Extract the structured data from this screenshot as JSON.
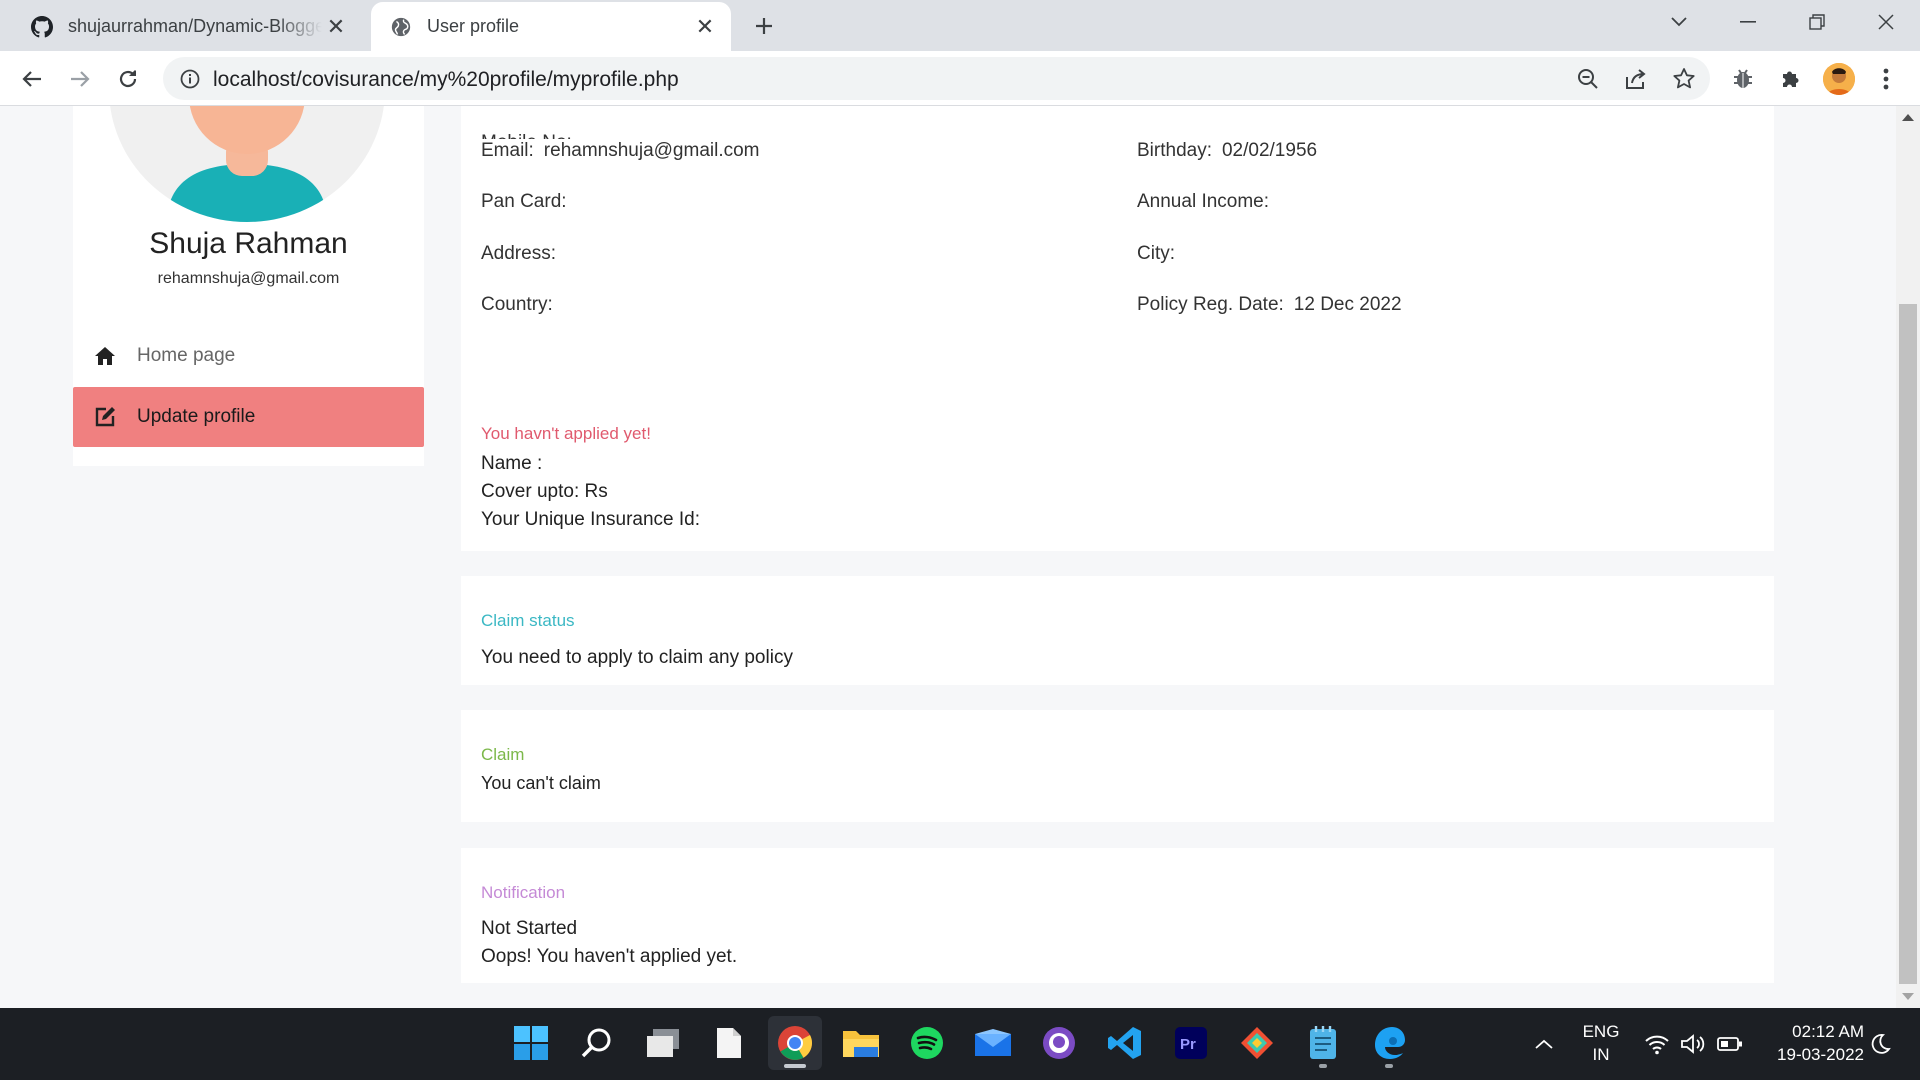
{
  "browser": {
    "tabs": [
      {
        "title": "shujaurrahman/Dynamic-Blogger",
        "favicon": "github-icon",
        "active": false
      },
      {
        "title": "User profile",
        "favicon": "globe-icon",
        "active": true
      }
    ],
    "url": "localhost/covisurance/my%20profile/myprofile.php"
  },
  "profile": {
    "name": "Shuja Rahman",
    "email": "rehamnshuja@gmail.com"
  },
  "sidebar": {
    "items": [
      {
        "label": "Home page",
        "icon": "home-icon"
      },
      {
        "label": "Update profile",
        "icon": "edit-icon",
        "active": true
      }
    ]
  },
  "details": {
    "email_label": "Email:",
    "email_value": "rehamnshuja@gmail.com",
    "birthday_label": "Birthday:",
    "birthday_value": "02/02/1956",
    "pan_label": "Pan Card:",
    "income_label": "Annual Income:",
    "address_label": "Address:",
    "city_label": "City:",
    "country_label": "Country:",
    "policy_label": "Policy Reg. Date:",
    "policy_value": "12 Dec 2022"
  },
  "status": {
    "heading": "You havn't applied yet!",
    "name_line": "Name :",
    "cover_line": "Cover upto: Rs",
    "id_line": "Your Unique Insurance Id:"
  },
  "claim_status": {
    "heading": "Claim status",
    "text": "You need to apply to claim any policy"
  },
  "claim": {
    "heading": "Claim",
    "text": "You can't claim"
  },
  "notification": {
    "heading": "Notification",
    "line1": "Not Started",
    "line2": "Oops! You haven't applied yet."
  },
  "taskbar": {
    "lang_top": "ENG",
    "lang_bottom": "IN",
    "time": "02:12 AM",
    "date": "19-03-2022"
  },
  "colors": {
    "accent_red": "#f08080",
    "status_heading": "#e05a6e",
    "claim_status_heading": "#3bb8c4",
    "claim_heading": "#7cb84a",
    "notification_heading": "#c58ad6"
  }
}
